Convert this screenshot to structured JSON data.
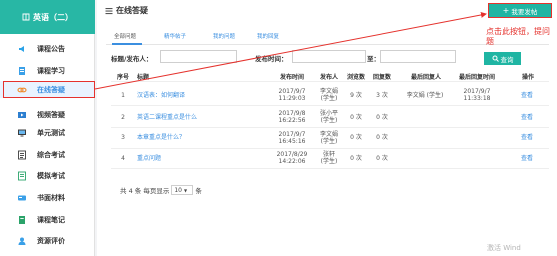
{
  "course": {
    "title": "英语（二）"
  },
  "sidebar": {
    "items": [
      {
        "label": "课程公告",
        "icon": "speaker-icon"
      },
      {
        "label": "课程学习",
        "icon": "document-icon"
      },
      {
        "label": "在线答疑",
        "icon": "link-icon"
      },
      {
        "label": "视频答疑",
        "icon": "video-icon"
      },
      {
        "label": "单元测试",
        "icon": "monitor-icon"
      },
      {
        "label": "综合考试",
        "icon": "list-icon"
      },
      {
        "label": "模拟考试",
        "icon": "form-icon"
      },
      {
        "label": "书面材料",
        "icon": "card-icon"
      },
      {
        "label": "课程笔记",
        "icon": "notebook-icon"
      },
      {
        "label": "资源评价",
        "icon": "person-icon"
      }
    ],
    "active_index": 2
  },
  "header": {
    "title": "在线答疑",
    "post_button": "我要发帖"
  },
  "tabs": [
    {
      "label": "全部问题"
    },
    {
      "label": "精华帖子"
    },
    {
      "label": "我的问题"
    },
    {
      "label": "我的回复"
    }
  ],
  "filters": {
    "title_poster_label": "标题/发布人：",
    "time_label": "发布时间：",
    "to_label": "至：",
    "query_button": "查询"
  },
  "table": {
    "headers": [
      "序号",
      "标题",
      "发布时间",
      "发布人",
      "浏览数",
      "回复数",
      "最后回复人",
      "最后回复时间",
      "操作"
    ],
    "rows": [
      {
        "no": "1",
        "title": "汉语表：如何翻译",
        "date": "2017/9/7",
        "time": "11:29:03",
        "poster": "李文娟",
        "poster2": "(学生)",
        "views": "9 次",
        "replies": "3 次",
        "last_replier": "李文娟 (学生)",
        "last_date": "2017/9/7",
        "last_time": "11:33:18",
        "action": "查看"
      },
      {
        "no": "2",
        "title": "英语二课程重点是什么",
        "date": "2017/9/8",
        "time": "16:22:56",
        "poster": "张小平",
        "poster2": "(学生)",
        "views": "0 次",
        "replies": "0 次",
        "last_replier": "",
        "last_date": "",
        "last_time": "",
        "action": "查看"
      },
      {
        "no": "3",
        "title": "本章重点是什么？",
        "date": "2017/9/7",
        "time": "16:45:16",
        "poster": "李文娟",
        "poster2": "(学生)",
        "views": "0 次",
        "replies": "0 次",
        "last_replier": "",
        "last_date": "",
        "last_time": "",
        "action": "查看"
      },
      {
        "no": "4",
        "title": "重点问题",
        "date": "2017/8/29",
        "time": "14:22:06",
        "poster": "张轩",
        "poster2": "(学生)",
        "views": "0 次",
        "replies": "0 次",
        "last_replier": "",
        "last_date": "",
        "last_time": "",
        "action": "查看"
      }
    ]
  },
  "pagination": {
    "prefix": "共 4 条 每页显示",
    "page_size": "10",
    "suffix": "条"
  },
  "annotation": {
    "text": "点击此按钮，提问题"
  },
  "watermark": {
    "text": "激活 Wind"
  },
  "colors": {
    "accent": "#1fb5a3",
    "link": "#3b8fe0",
    "highlight": "#e5322d"
  }
}
